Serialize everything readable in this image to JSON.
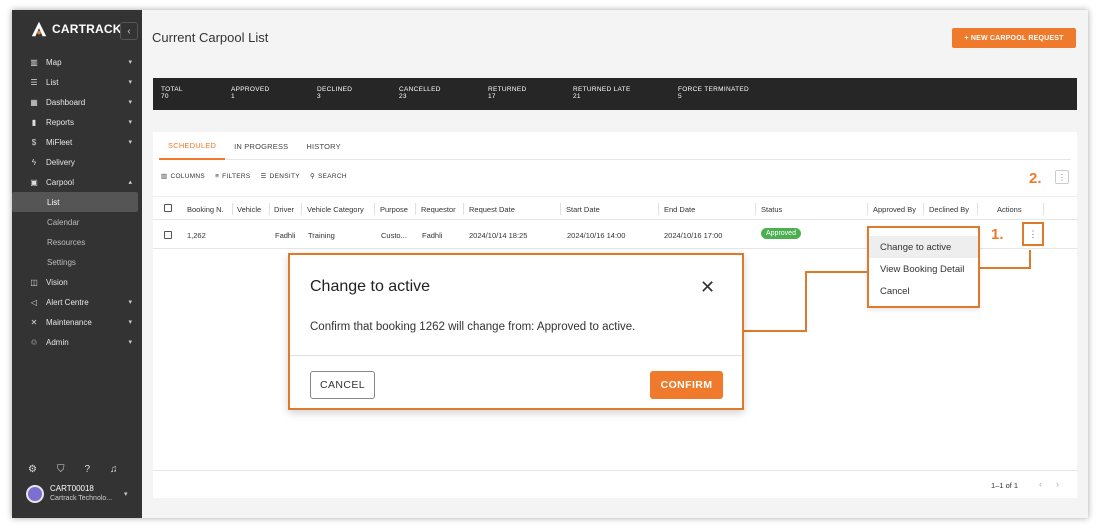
{
  "app": {
    "brand": "CARTRACK",
    "page_title": "Current Carpool List"
  },
  "sidebar": {
    "items": [
      {
        "label": "Map",
        "icon": "map-icon"
      },
      {
        "label": "List",
        "icon": "list-icon"
      },
      {
        "label": "Dashboard",
        "icon": "dashboard-icon"
      },
      {
        "label": "Reports",
        "icon": "reports-icon"
      },
      {
        "label": "MiFleet",
        "icon": "dollar-icon"
      },
      {
        "label": "Delivery",
        "icon": "delivery-icon"
      },
      {
        "label": "Carpool",
        "icon": "calendar-icon"
      }
    ],
    "carpool_sub": [
      "List",
      "Calendar",
      "Resources",
      "Settings"
    ],
    "items_after": [
      {
        "label": "Vision",
        "icon": "vision-icon"
      },
      {
        "label": "Alert Centre",
        "icon": "megaphone-icon"
      },
      {
        "label": "Maintenance",
        "icon": "tools-icon"
      },
      {
        "label": "Admin",
        "icon": "admin-icon"
      }
    ],
    "user": {
      "name": "CART00018",
      "company": "Cartrack Technolo..."
    }
  },
  "header": {
    "new_button": "+ NEW CARPOOL REQUEST"
  },
  "stats": [
    {
      "label": "TOTAL",
      "value": "70"
    },
    {
      "label": "APPROVED",
      "value": "1"
    },
    {
      "label": "DECLINED",
      "value": "3"
    },
    {
      "label": "CANCELLED",
      "value": "23"
    },
    {
      "label": "RETURNED",
      "value": "17"
    },
    {
      "label": "RETURNED LATE",
      "value": "21"
    },
    {
      "label": "FORCE TERMINATED",
      "value": "5"
    }
  ],
  "tabs": [
    "SCHEDULED",
    "IN PROGRESS",
    "HISTORY"
  ],
  "toolbar": {
    "columns": "COLUMNS",
    "filters": "FILTERS",
    "density": "DENSITY",
    "search": "SEARCH"
  },
  "table": {
    "headers": [
      "Booking N.",
      "Vehicle",
      "Driver",
      "Vehicle Category",
      "Purpose",
      "Requestor",
      "Request Date",
      "Start Date",
      "End Date",
      "Status",
      "Approved By",
      "Declined By",
      "Actions"
    ],
    "rows": [
      {
        "booking": "1,262",
        "vehicle": "",
        "driver": "Fadhli",
        "category": "Training",
        "purpose": "Custo...",
        "requestor": "Fadhli",
        "request_date": "2024/10/14 18:25",
        "start_date": "2024/10/16 14:00",
        "end_date": "2024/10/16 17:00",
        "status": "Approved"
      }
    ]
  },
  "pagination": {
    "text": "1–1 of 1"
  },
  "annotations": {
    "step1": "1.",
    "step2": "2."
  },
  "context_menu": [
    "Change to active",
    "View Booking Detail",
    "Cancel"
  ],
  "modal": {
    "title": "Change to active",
    "message": "Confirm that booking 1262 will change from: Approved to active.",
    "cancel": "CANCEL",
    "confirm": "CONFIRM"
  },
  "colors": {
    "accent": "#f07a2b",
    "sidebar": "#333333",
    "status_green": "#4caf50"
  }
}
